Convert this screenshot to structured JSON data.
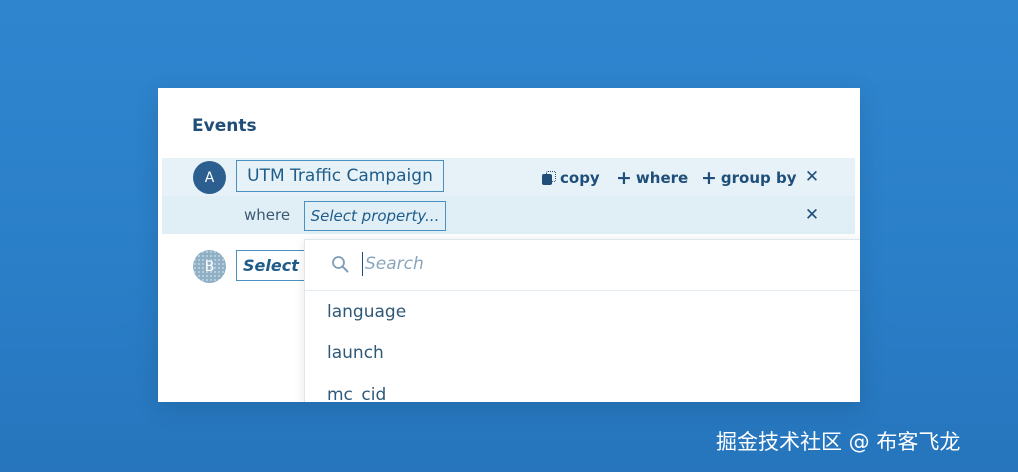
{
  "panel": {
    "title": "Events"
  },
  "event_a": {
    "badge": "A",
    "name": "UTM Traffic Campaign",
    "actions": {
      "copy_label": "copy",
      "where_label": "where",
      "group_by_label": "group by",
      "plus_glyph": "+",
      "close_glyph": "✕"
    },
    "filter": {
      "where_label": "where",
      "property_placeholder": "Select property...",
      "close_glyph": "✕"
    }
  },
  "event_b": {
    "badge": "B",
    "select_label": "Select e"
  },
  "dropdown": {
    "search_placeholder": "Search",
    "items": [
      "language",
      "launch",
      "mc_cid"
    ]
  },
  "watermark": "掘金技术社区 @ 布客飞龙",
  "icons": {
    "search": "search-icon",
    "copy": "copy-icon",
    "close": "close-icon"
  },
  "colors": {
    "background": "#2f86cf",
    "accent": "#1f4e79",
    "row_highlight": "#e6f2f8"
  }
}
